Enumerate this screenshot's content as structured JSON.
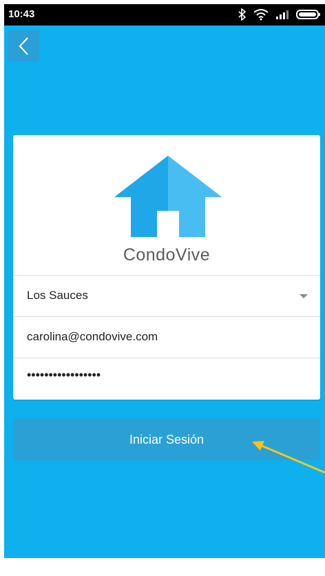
{
  "status_bar": {
    "time": "10:43",
    "icons": [
      "bluetooth-icon",
      "wifi-icon",
      "signal-icon",
      "battery-icon"
    ]
  },
  "nav": {
    "back_icon": "chevron-left-icon"
  },
  "app": {
    "logo_icon": "house-icon",
    "name": "CondoVive"
  },
  "form": {
    "condo_select": "Los Sauces",
    "email": "carolina@condovive.com",
    "password": "•••••••••••••••••"
  },
  "login_button": {
    "label": "Iniciar Sesión"
  },
  "colors": {
    "background": "#0fb0ee",
    "button": "#2aa0d5",
    "annotation_arrow": "#f5c518"
  }
}
